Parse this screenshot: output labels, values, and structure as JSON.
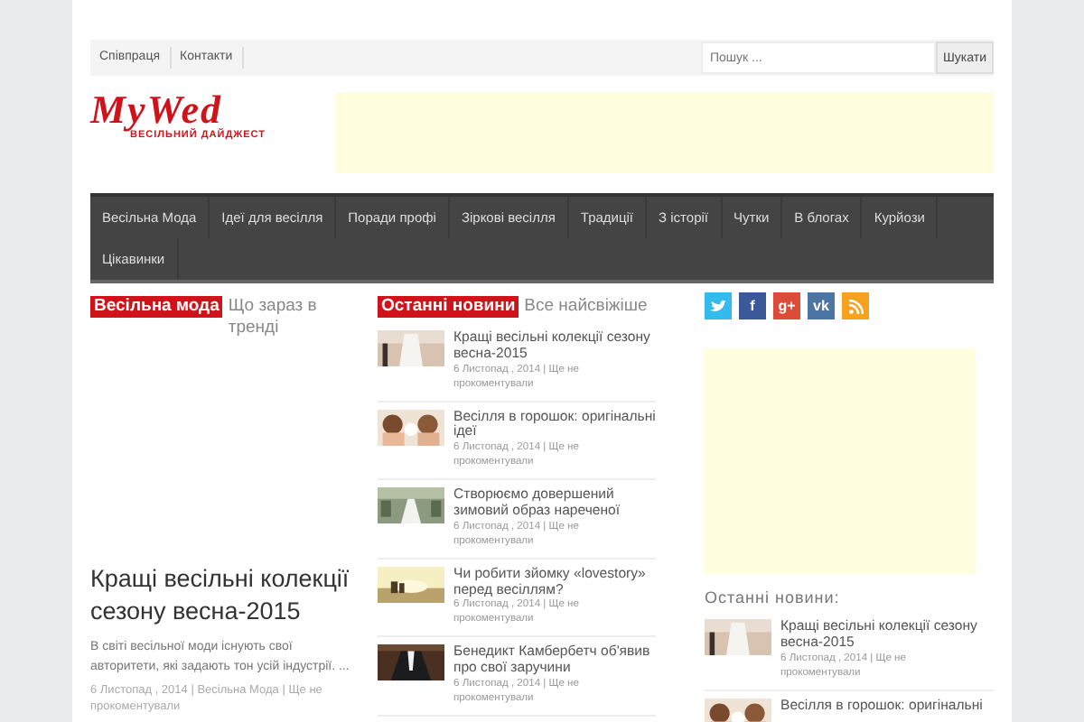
{
  "top_bar": {
    "links": [
      "Співпраця",
      "Контакти"
    ],
    "search": {
      "placeholder": "Пошук ...",
      "button": "Шукати"
    }
  },
  "logo": {
    "title": "MyWed",
    "subtitle": "ВЕСІЛЬНИЙ ДАЙДЖЕСТ"
  },
  "nav": [
    "Весільна Мода",
    "Ідеї для весілля",
    "Поради профі",
    "Зіркові весілля",
    "Традиції",
    "З історії",
    "Чутки",
    "В блогах",
    "Курйози",
    "Цікавинки"
  ],
  "featured": {
    "tag": "Весільна мода",
    "subtitle": "Що зараз в тренді",
    "headline": "Кращі весільні колекції сезону весна-2015",
    "excerpt": "В світі весільної моди існують свої авторитети, які задають тон усій індустрії. ...",
    "meta": "6 Листопад , 2014 | Весільна Мода | Ще не прокоментували"
  },
  "latest": {
    "tag": "Останні новини",
    "subtitle": "Все найсвіжіше",
    "items": [
      {
        "title": "Кращі весільні колекції сезону весна-2015",
        "meta": "6 Листопад , 2014 | Ще не прокоментували"
      },
      {
        "title": "Весілля в горошок: оригінальні ідеї",
        "meta": "6 Листопад , 2014 | Ще не прокоментували"
      },
      {
        "title": "Створюємо довершений зимовий образ нареченої",
        "meta": "6 Листопад , 2014 | Ще не прокоментували"
      },
      {
        "title": "Чи робити зйомку «lovestory» перед весіллям?",
        "meta": "6 Листопад , 2014 | Ще не прокоментували"
      },
      {
        "title": "Бенедикт Камбербетч об'явив про свої заручини",
        "meta": "6 Листопад , 2014 | Ще не прокоментували"
      }
    ]
  },
  "social": [
    {
      "kind": "twitter",
      "color": "#33bbee"
    },
    {
      "kind": "glyph",
      "label": "f",
      "color": "#3b5998"
    },
    {
      "kind": "glyph",
      "label": "g+",
      "color": "#dd4b39"
    },
    {
      "kind": "glyph",
      "label": "vk",
      "color": "#4c75a3"
    },
    {
      "kind": "rss",
      "color": "#f7a21e"
    }
  ],
  "sidebar": {
    "heading": "Останні новини:",
    "items": [
      {
        "title": "Кращі весільні колекції сезону весна-2015",
        "meta": "6 Листопад , 2014 | Ще не прокоментували"
      },
      {
        "title": "Весілля в горошок: оригінальні"
      }
    ]
  }
}
